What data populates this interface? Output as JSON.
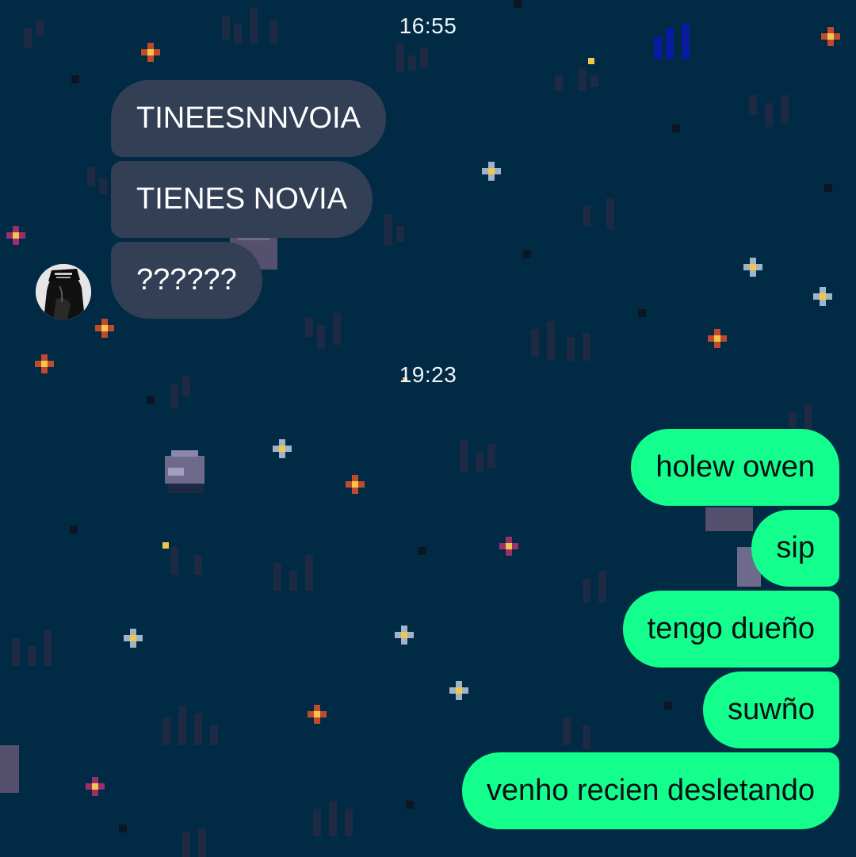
{
  "chat": {
    "groups": [
      {
        "time": "16:55",
        "direction": "incoming",
        "messages": [
          "TINEESNNVOIA",
          "TIENES NOVIA",
          "??????"
        ]
      },
      {
        "time": "19:23",
        "direction": "outgoing",
        "messages": [
          "holew owen",
          "sip",
          "tengo dueño",
          "suwño",
          "venho recien desletando"
        ]
      }
    ],
    "avatar_icon": "contact-avatar",
    "colors": {
      "background": "#012a45",
      "incoming_bubble": "#323f55",
      "outgoing_bubble": "#13fe8c",
      "incoming_text": "#ffffff",
      "outgoing_text": "#0a0f14"
    }
  }
}
